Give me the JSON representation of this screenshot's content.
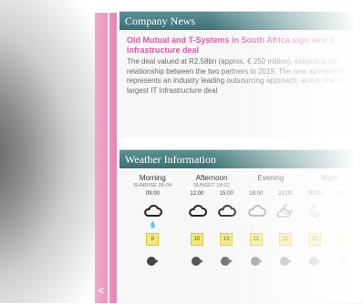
{
  "sidebar": {
    "collapse_label": "<"
  },
  "news": {
    "header": "Company News",
    "title": "Old Mutual and T-Systems in South Africa sign new €... infrastructure deal",
    "body": "The deal valued at R2.58bn (approx. € 250 million), extending the relationship between the two partners to 2019. The new agreement represents an industry leading outsourcing approach, and is one of the largest IT infrastructure deal"
  },
  "weather": {
    "header": "Weather Information",
    "periods": [
      {
        "name": "Morning",
        "sun_event": "SUNRISE 06:04",
        "times": [
          "09:00"
        ],
        "icons": [
          "cloud-rain"
        ],
        "temps": [
          "8"
        ]
      },
      {
        "name": "Afternoon",
        "sun_event": "SUNSET 18:02",
        "times": [
          "12:00",
          "15:00"
        ],
        "icons": [
          "cloud",
          "cloud"
        ],
        "temps": [
          "10",
          "13"
        ]
      },
      {
        "name": "Evening",
        "sun_event": "",
        "times": [
          "18:00",
          "21:00"
        ],
        "icons": [
          "cloud",
          "cloud-moon"
        ],
        "temps": [
          "12",
          "11"
        ]
      },
      {
        "name": "Night",
        "sun_event": "",
        "times": [
          "00:00",
          "03:00"
        ],
        "icons": [
          "moon",
          "cloud"
        ],
        "temps": [
          "10",
          "10"
        ]
      }
    ],
    "colors": {
      "temp_badge": "#f3e97a",
      "header_bg": "#3b6f73",
      "news_title": "#d85aa0"
    }
  }
}
